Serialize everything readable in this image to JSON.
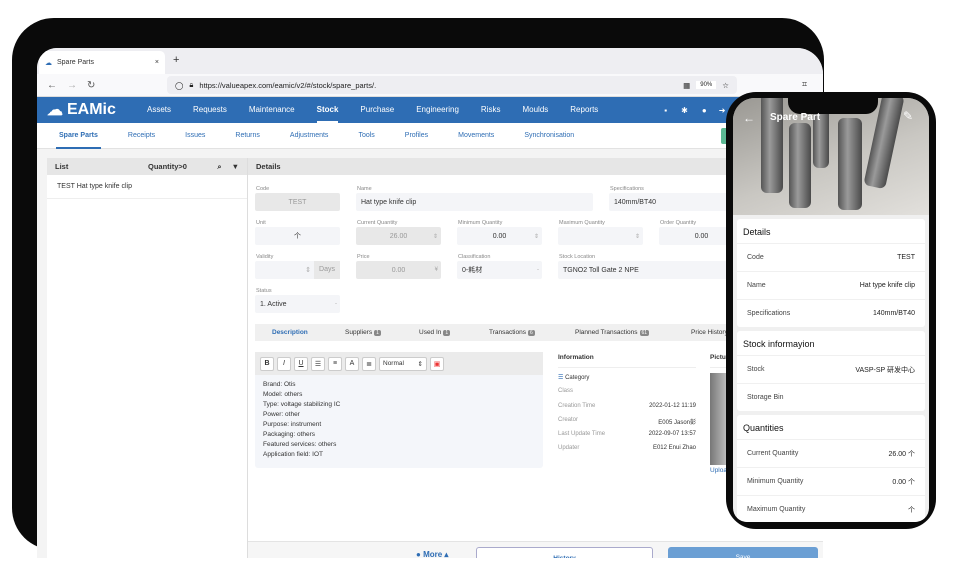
{
  "browser": {
    "tab_title": "Spare Parts",
    "url": "https://valueapex.com/eamic/v2/#/stock/spare_parts/.",
    "zoom": "90%"
  },
  "nav": {
    "logo": "EAMic",
    "items": [
      "Assets",
      "Requests",
      "Maintenance",
      "Stock",
      "Purchase",
      "Engineering",
      "Risks",
      "Moulds",
      "Reports"
    ],
    "active": "Stock",
    "brand_color": "#2e6db4"
  },
  "subnav": {
    "items": [
      "Spare Parts",
      "Receipts",
      "Issues",
      "Returns",
      "Adjustments",
      "Tools",
      "Profiles",
      "Movements",
      "Synchronisation"
    ]
  },
  "list": {
    "title": "List",
    "filter": "Quantity>0",
    "items": [
      "TEST Hat type knife clip"
    ]
  },
  "details": {
    "title": "Details",
    "code_label": "Code",
    "code": "TEST",
    "name_label": "Name",
    "name": "Hat type knife clip",
    "spec_label": "Specifications",
    "spec": "140mm/BT40",
    "unit_label": "Unit",
    "unit": "个",
    "cur_label": "Current Quantity",
    "cur": "26.00",
    "min_label": "Minimum Quantity",
    "min": "0.00",
    "max_label": "Maximum Quantity",
    "max": "",
    "order_label": "Order Quantity",
    "order": "0.00",
    "validity_label": "Validity",
    "validity_unit": "Days",
    "price_label": "Price",
    "price": "0.00",
    "currency": "¥",
    "class_label": "Classification",
    "class": "0-耗材",
    "loc_label": "Stock Location",
    "loc": "TGNO2 Toll Gate 2 NPE",
    "status_label": "Status",
    "status": "1. Active"
  },
  "tabs": [
    {
      "label": "Description"
    },
    {
      "label": "Suppliers",
      "count": "1"
    },
    {
      "label": "Used In",
      "count": "1"
    },
    {
      "label": "Transactions",
      "count": "6"
    },
    {
      "label": "Planned Transactions",
      "count": "61"
    },
    {
      "label": "Price History",
      "count": ""
    }
  ],
  "editor": {
    "format": "Normal",
    "lines": [
      "Brand: Otis",
      "Model: others",
      "Type: voltage stabilizing IC",
      "Power: other",
      "Purpose: instrument",
      "Packaging: others",
      "Featured services: others",
      "Application field: IOT"
    ]
  },
  "information": {
    "title": "Information",
    "category": "Category",
    "rows": [
      [
        "Class",
        ""
      ],
      [
        "Creation Time",
        "2022-01-12 11:19"
      ],
      [
        "Creator",
        "E005 Jason彭"
      ],
      [
        "Last Update Time",
        "2022-09-07 13:57"
      ],
      [
        "Updater",
        "E012 Enui Zhao"
      ]
    ]
  },
  "picture": {
    "title": "Picture",
    "upload": "Upload p"
  },
  "footer": {
    "more": "More",
    "history": "History",
    "save": "Save"
  },
  "phone": {
    "title": "Spare Part",
    "details_title": "Details",
    "details": [
      [
        "Code",
        "TEST"
      ],
      [
        "Name",
        "Hat type knife clip"
      ],
      [
        "Specifications",
        "140mm/BT40"
      ]
    ],
    "stock_title": "Stock informayion",
    "stock": [
      [
        "Stock",
        "VASP-SP 研发中心"
      ],
      [
        "Storage Bin",
        ""
      ]
    ],
    "qty_title": "Quantities",
    "qty": [
      [
        "Current Quantity",
        "26.00 个"
      ],
      [
        "Minimum Quantity",
        "0.00 个"
      ],
      [
        "Maximum Quantity",
        "个"
      ]
    ]
  }
}
